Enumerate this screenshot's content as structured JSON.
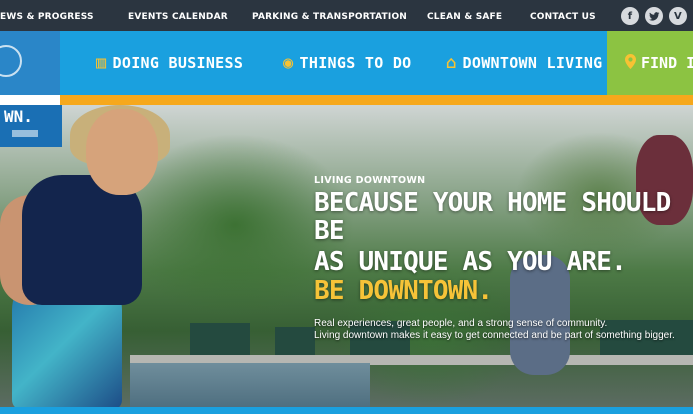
{
  "top_nav": {
    "items": [
      {
        "label": "EWS & PROGRESS"
      },
      {
        "label": "EVENTS CALENDAR"
      },
      {
        "label": "PARKING & TRANSPORTATION"
      },
      {
        "label": "CLEAN & SAFE"
      },
      {
        "label": "CONTACT US"
      }
    ],
    "social": [
      {
        "icon": "facebook-icon",
        "glyph": "f"
      },
      {
        "icon": "twitter-icon",
        "glyph": "t"
      },
      {
        "icon": "vimeo-icon",
        "glyph": "V"
      }
    ]
  },
  "main_nav": {
    "items": [
      {
        "label": "DOING BUSINESS",
        "icon": "buildings-icon",
        "glyph": "▥"
      },
      {
        "label": "THINGS TO DO",
        "icon": "ticket-icon",
        "glyph": "◉"
      },
      {
        "label": "DOWNTOWN LIVING",
        "icon": "home-icon",
        "glyph": "⌂"
      },
      {
        "label": "FIND IT",
        "icon": "location-pin-icon",
        "glyph": "♥"
      }
    ]
  },
  "hero": {
    "tab_label": "WN.",
    "eyebrow": "LIVING DOWNTOWN",
    "headline_line1": "BECAUSE YOUR HOME SHOULD BE",
    "headline_line2": "AS UNIQUE AS YOU ARE.",
    "headline_accent": "BE DOWNTOWN.",
    "body_line1": "Real experiences, great people, and a strong sense of community.",
    "body_line2": "Living downtown makes it easy to get connected and be part of something bigger."
  },
  "colors": {
    "top_bar": "#2b3540",
    "nav_blue": "#1aa0df",
    "find_green": "#8cc342",
    "accent_orange": "#f6a81c",
    "accent_yellow": "#f6c338"
  }
}
